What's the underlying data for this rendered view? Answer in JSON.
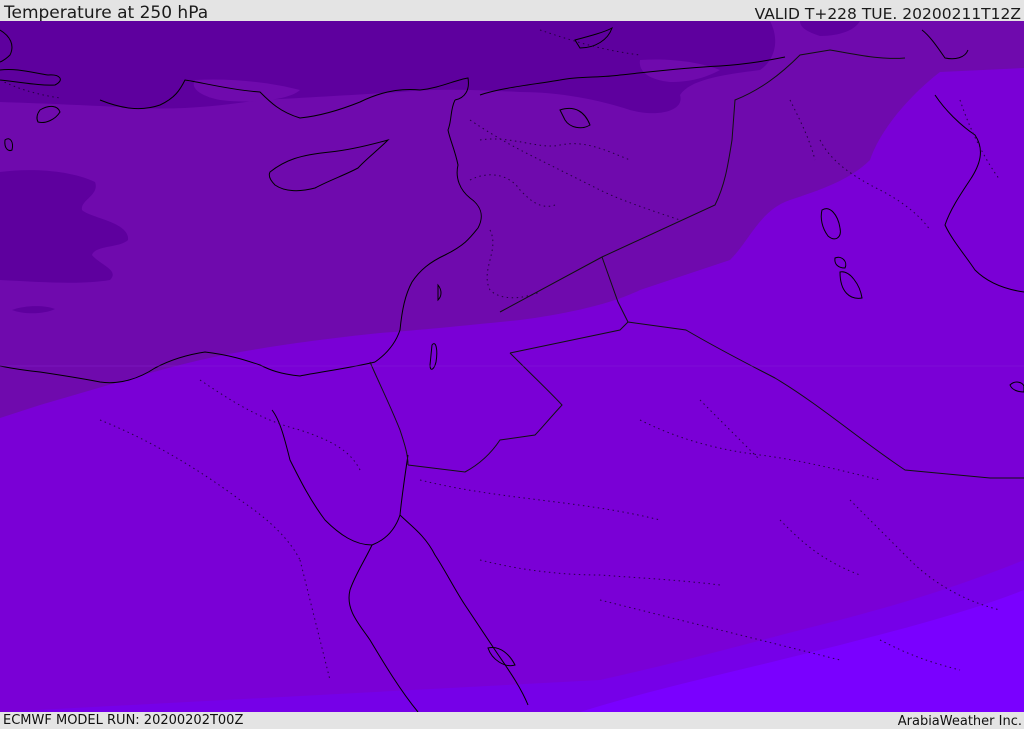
{
  "header": {
    "title": "Temperature at 250 hPa",
    "valid": "VALID T+228 TUE. 20200211T12Z"
  },
  "footer": {
    "model_run": "ECMWF MODEL RUN: 20200202T00Z",
    "credit": "ArabiaWeather Inc."
  },
  "map": {
    "colors": {
      "band_coldest": "#5e009e",
      "band_cold": "#6f0aad",
      "band_mid": "#7a00d6",
      "band_warm": "#7600e8",
      "band_warmest": "#7a00ff",
      "coastline": "#000000",
      "border": "#1a0030"
    }
  }
}
